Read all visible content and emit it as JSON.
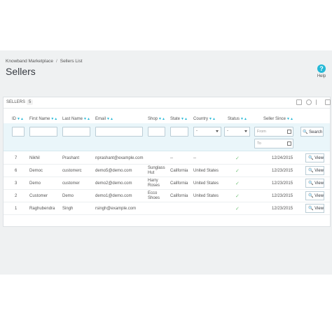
{
  "breadcrumb": {
    "root": "Knowband Marketplace",
    "current": "Sellers List"
  },
  "page": {
    "title": "Sellers",
    "help_label": "Help"
  },
  "panel": {
    "title": "SELLERS",
    "count": "5"
  },
  "columns": [
    "ID",
    "First Name",
    "Last Name",
    "Email",
    "Shop",
    "State",
    "Country",
    "Status",
    "Seller Since"
  ],
  "filters": {
    "country_selected": "-",
    "status_selected": "-",
    "from_placeholder": "From",
    "to_placeholder": "To",
    "search_label": "Search"
  },
  "rows": [
    {
      "id": "7",
      "first": "Nikhil",
      "last": "Prashant",
      "email": "nprashant@example.com",
      "shop": "",
      "state": "--",
      "country": "--",
      "status": "✓",
      "since": "12/24/2015",
      "action": "View"
    },
    {
      "id": "6",
      "first": "Democ",
      "last": "customerc",
      "email": "demo5@demo.com",
      "shop": "Sunglass Hut",
      "state": "California",
      "country": "United States",
      "status": "✓",
      "since": "12/23/2015",
      "action": "View"
    },
    {
      "id": "3",
      "first": "Demo",
      "last": "customer",
      "email": "demo2@demo.com",
      "shop": "Harry Roses",
      "state": "California",
      "country": "United States",
      "status": "✓",
      "since": "12/23/2015",
      "action": "View"
    },
    {
      "id": "2",
      "first": "Customer",
      "last": "Demo",
      "email": "demo1@demo.com",
      "shop": "Ecco Shoes",
      "state": "California",
      "country": "United States",
      "status": "✓",
      "since": "12/23/2015",
      "action": "View"
    },
    {
      "id": "1",
      "first": "Raghubendra",
      "last": "Singh",
      "email": "rsingh@example.com",
      "shop": "",
      "state": "",
      "country": "",
      "status": "✓",
      "since": "12/23/2015",
      "action": "View"
    }
  ],
  "colors": {
    "accent": "#25b9d7",
    "check": "#72c279",
    "filter_bg": "#eaf6fa"
  },
  "icons": [
    "help-icon",
    "sort-arrows-icon",
    "calendar-icon",
    "search-icon",
    "check-icon"
  ]
}
